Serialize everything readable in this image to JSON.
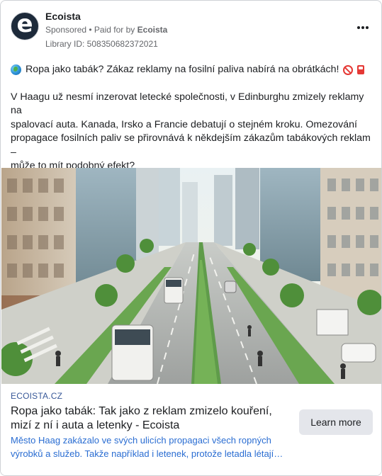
{
  "advertiser": {
    "name": "Ecoista",
    "avatar_letter": "e",
    "sponsored_label": "Sponsored",
    "paid_for_prefix": "• Paid for by",
    "paid_for_name": "Ecoista",
    "library_id": "Library ID: 508350682372021"
  },
  "post": {
    "headline": "Ropa jako tabák? Zákaz reklamy na fosilní paliva nabírá na obrátkách!",
    "headline_icons": [
      "globe-icon",
      "no-entry-icon",
      "fuel-pump-icon"
    ],
    "lines": [
      "V Haagu už nesmí inzerovat letecké společnosti, v Edinburghu zmizely reklamy na",
      "spalovací auta. Kanada, Irsko a Francie debatují o stejném kroku. Omezování",
      "propagace fosilních paliv se přirovnává k někdejším zákazům tabákových reklam –",
      "může to mít podobný efekt?"
    ],
    "ellipsis": "…"
  },
  "link_preview": {
    "domain": "ECOISTA.CZ",
    "title": "Ropa jako tabák: Tak jako z reklam zmizelo kouření, mizí z ní i auta a letenky - Ecoista",
    "description": "Město Haag zakázalo ve svých ulicích propagaci všech ropných výrobků a služeb. Takže například i letenek, protože letadla létají…",
    "cta_label": "Learn more"
  },
  "colors": {
    "link_blue": "#2a6dd2",
    "domain_blue": "#385898",
    "muted_text": "#65676b",
    "button_bg": "#e4e6eb"
  }
}
